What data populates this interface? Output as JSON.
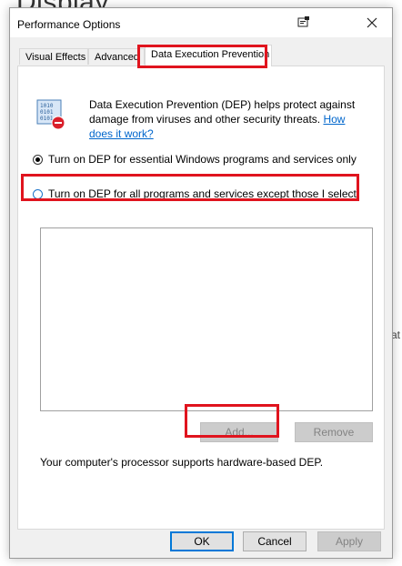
{
  "background": {
    "heading": "Display",
    "side_fragment": "at"
  },
  "window": {
    "title": "Performance Options",
    "help_icon": "help-window-icon",
    "close_icon": "close-icon"
  },
  "tabs": [
    {
      "label": "Visual Effects",
      "active": false
    },
    {
      "label": "Advanced",
      "active": false
    },
    {
      "label": "Data Execution Prevention",
      "active": true
    }
  ],
  "dep": {
    "icon": "dep-shield-binary-icon",
    "description": "Data Execution Prevention (DEP) helps protect against damage from viruses and other security threats. ",
    "link_text": "How does it work?",
    "option1_label": "Turn on DEP for essential Windows programs and services only",
    "option1_checked": true,
    "option2_label": "Turn on DEP for all programs and services except those I select:",
    "option2_checked": false,
    "program_list": [],
    "add_label": "Add...",
    "remove_label": "Remove",
    "hardware_text": "Your computer's processor supports hardware-based DEP."
  },
  "footer": {
    "ok_label": "OK",
    "cancel_label": "Cancel",
    "apply_label": "Apply"
  },
  "colors": {
    "highlight": "#e0141e",
    "link": "#0066cc",
    "accent": "#0078d7"
  }
}
